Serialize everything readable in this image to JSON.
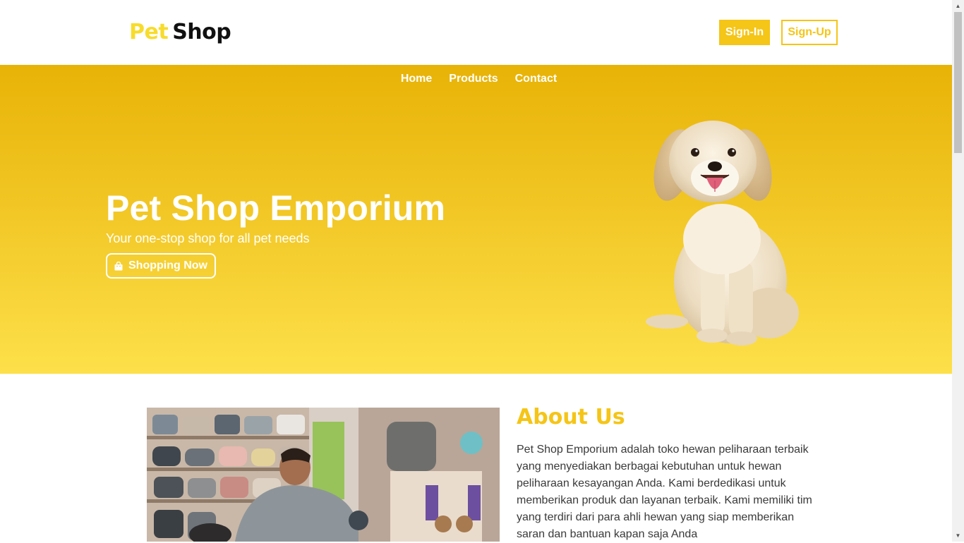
{
  "header": {
    "logo_part1": "Pet",
    "logo_part2": "Shop",
    "signin_label": "Sign-In",
    "signup_label": "Sign-Up"
  },
  "nav": {
    "items": [
      {
        "label": "Home"
      },
      {
        "label": "Products"
      },
      {
        "label": "Contact"
      }
    ]
  },
  "hero": {
    "title": "Pet Shop Emporium",
    "subtitle": "Your one-stop shop for all pet needs",
    "cta_label": "Shopping Now",
    "cta_icon": "shopping-bag-icon"
  },
  "about": {
    "title": "About Us",
    "text": "Pet Shop Emporium adalah toko hewan peliharaan terbaik yang menyediakan berbagai kebutuhan untuk hewan peliharaan kesayangan Anda. Kami berdedikasi untuk memberikan produk dan layanan terbaik. Kami memiliki tim yang terdiri dari para ahli hewan yang siap memberikan saran dan bantuan kapan saja Anda"
  },
  "colors": {
    "accent": "#f5c517",
    "logo_yellow": "#f7dc2c",
    "hero_top": "#e8b307",
    "hero_bottom": "#fde04a"
  }
}
